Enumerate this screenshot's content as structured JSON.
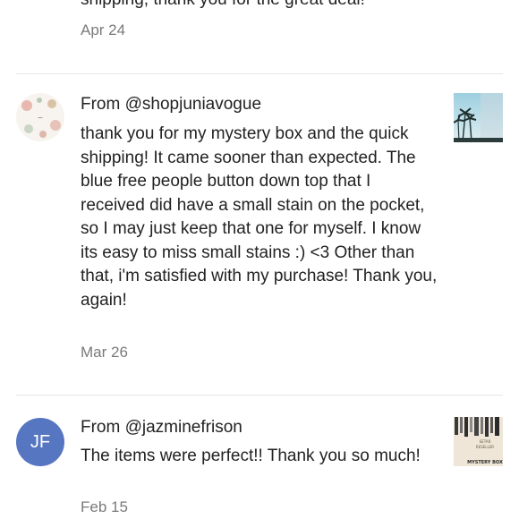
{
  "reviews": [
    {
      "cut_text": "shipping, thank you for the great deal!",
      "date": "Apr 24"
    },
    {
      "author": "From @shopjuniavogue",
      "avatar": "floral-logo-avatar",
      "text": "thank you for my mystery box and the quick shipping! It came sooner than expected. The blue free people button down top that I received did have a small stain on the pocket, so I may just keep that one for myself. I know its easy to miss small stains :) <3  Other than that, i'm satisfied with my purchase!  Thank you, again!",
      "date": "Mar 26",
      "thumb": "palm-trees-thumbnail"
    },
    {
      "author": "From @jazminefrison",
      "avatar_initials": "JF",
      "text": "The items were perfect!! Thank you so much!",
      "date": "Feb 15",
      "thumb": "mystery-box-thumbnail",
      "thumb_lines": [
        "SETAR",
        "RESELLER",
        "MYSTERY BOX"
      ]
    }
  ],
  "colors": {
    "avatar_jf": "#5676c2",
    "date": "#7a7a7a",
    "divider": "#e6e6e6"
  }
}
